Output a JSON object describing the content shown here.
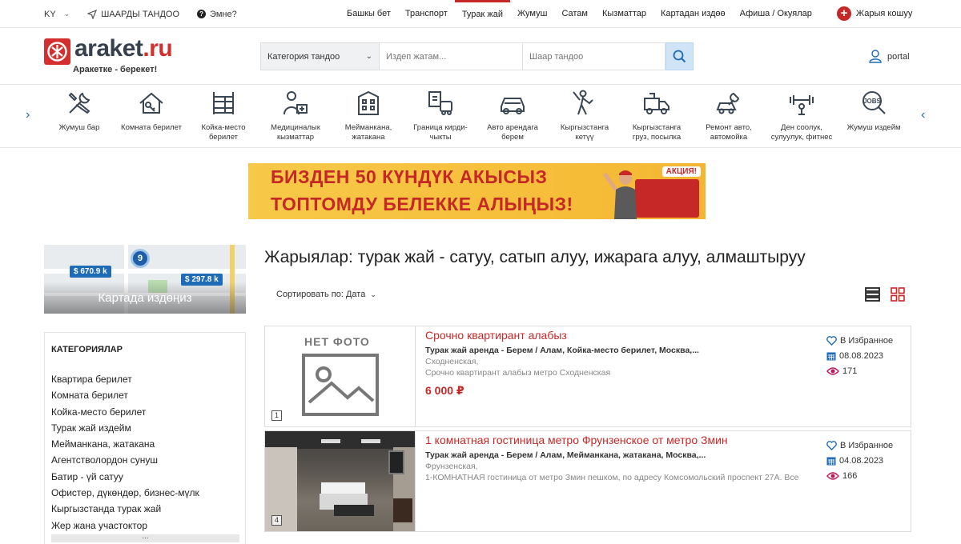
{
  "topbar": {
    "lang": "KY",
    "city_select": "ШААРДЫ ТАНДОО",
    "help": "Эмне?",
    "nav": [
      {
        "label": "Башкы бет",
        "active": false
      },
      {
        "label": "Транспорт",
        "active": false
      },
      {
        "label": "Турак жай",
        "active": true
      },
      {
        "label": "Жумуш",
        "active": false
      },
      {
        "label": "Сатам",
        "active": false
      },
      {
        "label": "Кызматтар",
        "active": false
      },
      {
        "label": "Картадан издөө",
        "active": false
      },
      {
        "label": "Афиша / Окуялар",
        "active": false
      }
    ],
    "post_ad": "Жарыя кошуу"
  },
  "header": {
    "logo_main": "araket",
    "logo_tld": ".ru",
    "slogan": "Аракетке - берекет!",
    "category_select": "Категория тандоо",
    "search_placeholder": "Издеп жатам...",
    "city_placeholder": "Шаар тандоо",
    "user": "portal"
  },
  "categories_strip": [
    {
      "icon": "tools-icon",
      "label": "Жумуш бар"
    },
    {
      "icon": "house-key-icon",
      "label": "Комната берилет"
    },
    {
      "icon": "bunk-bed-icon",
      "label": "Койка-место берилет"
    },
    {
      "icon": "medic-icon",
      "label": "Медициналык кызматтар"
    },
    {
      "icon": "hotel-icon",
      "label": "Мейманкана, жатакана"
    },
    {
      "icon": "border-docs-icon",
      "label": "Граница кирди-чыкты"
    },
    {
      "icon": "car-rent-icon",
      "label": "Авто арендага берем"
    },
    {
      "icon": "worker-icon",
      "label": "Кыргызстанга кетүү"
    },
    {
      "icon": "truck-icon",
      "label": "Кыргызстанга груз, посылка"
    },
    {
      "icon": "car-repair-icon",
      "label": "Ремонт авто, автомойка"
    },
    {
      "icon": "fitness-icon",
      "label": "Ден соолук, сулуулук, фитнес"
    },
    {
      "icon": "jobs-search-icon",
      "label": "Жумуш издейм"
    }
  ],
  "banner": {
    "line1": "БИЗДЕН 50 КҮНДҮК АКЫСЫЗ",
    "line2": "ТОПТОМДУ БЕЛЕККЕ АЛЫҢЫЗ!",
    "badge": "АКЦИЯ!"
  },
  "map": {
    "pin1": "$ 670.9 k",
    "pin2": "$ 297.8 k",
    "cluster": "9",
    "label": "Картада издөңиз"
  },
  "sidebar": {
    "title": "КАТЕГОРИЯЛАР",
    "items": [
      "Квартира берилет",
      "Комната берилет",
      "Койка-место берилет",
      "Турак жай издейм",
      "Мейманкана, жатакана",
      "Агентстволордон сунуш",
      "Батир - үй сатуу",
      "Офистер, дүкөндөр, бизнес-мүлк",
      "Кыргызстанда турак жай",
      "Жер жана участоктор"
    ],
    "more": "..."
  },
  "main": {
    "title": "Жарыялар: турак жай - сатуу, сатып алуу, ижарага алуу, алмаштыруу",
    "sort": "Сортировать по: Дата"
  },
  "listings": [
    {
      "no_photo": "НЕТ ФОТО",
      "photo_count": "1",
      "title": "Срочно квартирант алабыз",
      "categories": "Турак жай аренда - Берем / Алам, Койка-место берилет, Москва,...",
      "location": "Сходненская,",
      "description": "Срочно квартирант алабыз метро Сходненская",
      "price": "6 000 ₽",
      "favorite": "В Избранное",
      "date": "08.08.2023",
      "views": "171"
    },
    {
      "photo_count": "4",
      "title": "1 комнатная гостиница метро Фрунзенское от метро Змин",
      "categories": "Турак жай аренда - Берем / Алам, Мейманкана, жатакана, Москва,...",
      "location": "Фрунзенская,",
      "description": "1-КОМНАТНАЯ гостиница от метро Змин пешком, по адресу Комсомольский проспект 27А. Все",
      "favorite": "В Избранное",
      "date": "04.08.2023",
      "views": "166"
    }
  ],
  "colors": {
    "accent_red": "#c62828",
    "link_blue": "#1e6bb8",
    "icon_dark": "#3a4653"
  }
}
